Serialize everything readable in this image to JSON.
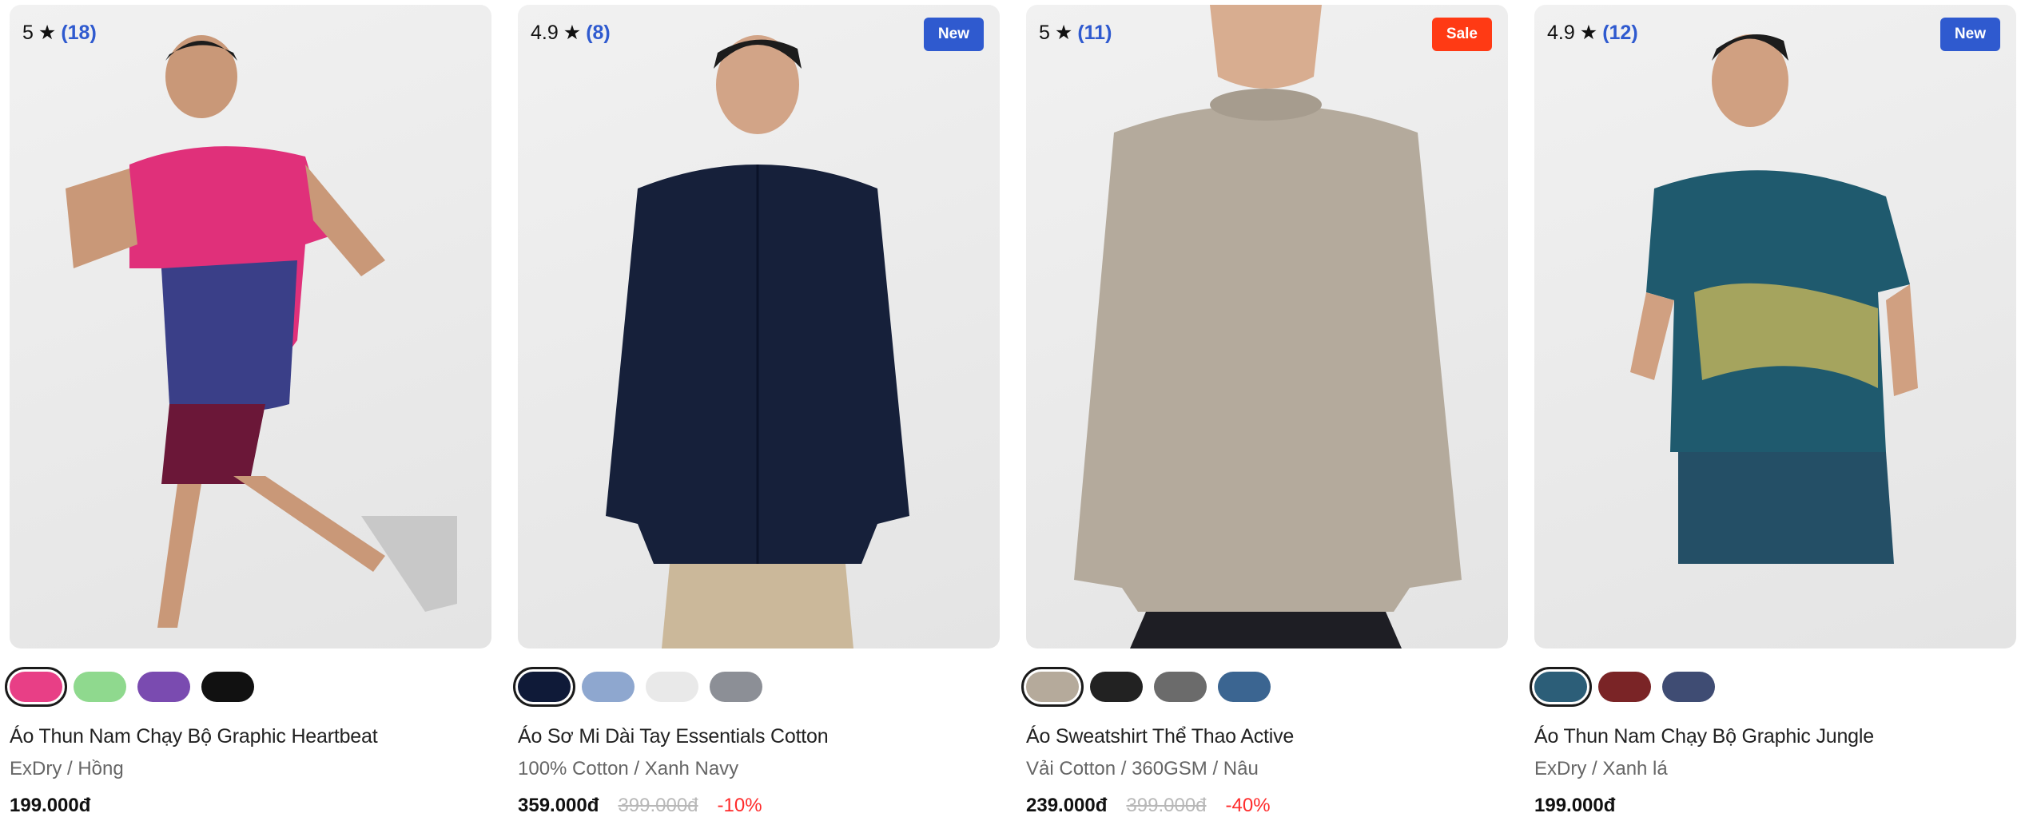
{
  "products": [
    {
      "rating": "5",
      "star": "★",
      "review_count": "(18)",
      "badge": "",
      "name": "Áo Thun Nam Chạy Bộ Graphic Heartbeat",
      "sub": "ExDry / Hồng",
      "price": "199.000đ",
      "old_price": "",
      "discount": "",
      "swatches": [
        "#e83f86",
        "#8fd98e",
        "#7a4bb0",
        "#111111"
      ]
    },
    {
      "rating": "4.9",
      "star": "★",
      "review_count": "(8)",
      "badge": "New",
      "name": "Áo Sơ Mi Dài Tay Essentials Cotton",
      "sub": "100% Cotton / Xanh Navy",
      "price": "359.000đ",
      "old_price": "399.000đ",
      "discount": "-10%",
      "swatches": [
        "#0f1a38",
        "#8ea7cf",
        "#e9e9e9",
        "#8c8f96"
      ]
    },
    {
      "rating": "5",
      "star": "★",
      "review_count": "(11)",
      "badge": "Sale",
      "name": "Áo Sweatshirt Thể Thao Active",
      "sub": "Vải Cotton / 360GSM / Nâu",
      "price": "239.000đ",
      "old_price": "399.000đ",
      "discount": "-40%",
      "swatches": [
        "#b5aa9b",
        "#222222",
        "#6b6b6b",
        "#3b6591"
      ]
    },
    {
      "rating": "4.9",
      "star": "★",
      "review_count": "(12)",
      "badge": "New",
      "name": "Áo Thun Nam Chạy Bộ Graphic Jungle",
      "sub": "ExDry / Xanh lá",
      "price": "199.000đ",
      "old_price": "",
      "discount": "",
      "swatches": [
        "#2c5e78",
        "#7a2426",
        "#3f4c73"
      ]
    }
  ],
  "colors": {
    "new_badge": "#2f5acf",
    "sale_badge": "#ff3a14",
    "review_count": "#2f5acf",
    "discount": "#ff2b2b"
  }
}
